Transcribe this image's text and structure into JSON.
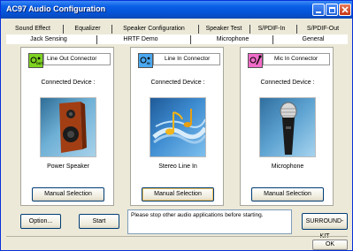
{
  "window": {
    "title": "AC97 Audio Configuration",
    "controls": [
      "minimize",
      "maximize",
      "close"
    ]
  },
  "tabs_row1": [
    "Sound Effect",
    "Equalizer",
    "Speaker Configuration",
    "Speaker Test",
    "S/PDIF-In",
    "S/PDIF-Out"
  ],
  "tabs_row2": [
    "Jack Sensing",
    "HRTF Demo",
    "Microphone",
    "General"
  ],
  "active_tab": "Jack Sensing",
  "panels": [
    {
      "connector": "Line Out Connector",
      "icon": "line-out-jack-icon",
      "icon_label": "OUT",
      "color": "#7ed321",
      "connected_label": "Connected Device :",
      "device": "Power Speaker",
      "device_icon": "speaker-icon",
      "button": "Manual Selection"
    },
    {
      "connector": "Line In Connector",
      "icon": "line-in-jack-icon",
      "icon_label": "IN",
      "color": "#4aa8f0",
      "connected_label": "Connected Device :",
      "device": "Stereo Line In",
      "device_icon": "music-notes-icon",
      "button": "Manual Selection"
    },
    {
      "connector": "Mic In Connector",
      "icon": "mic-in-jack-icon",
      "icon_label": "",
      "color": "#f06bc8",
      "connected_label": "Connected Device :",
      "device": "Microphone",
      "device_icon": "microphone-icon",
      "button": "Manual Selection"
    }
  ],
  "footer": {
    "option_button": "Option...",
    "start_button": "Start",
    "message": "Please stop other audio applications before starting.",
    "surround_button": "SURROUND-KIT",
    "ok_button": "OK"
  },
  "colors": {
    "titlebar": "#0453d6",
    "window_bg": "#ece9d8"
  }
}
